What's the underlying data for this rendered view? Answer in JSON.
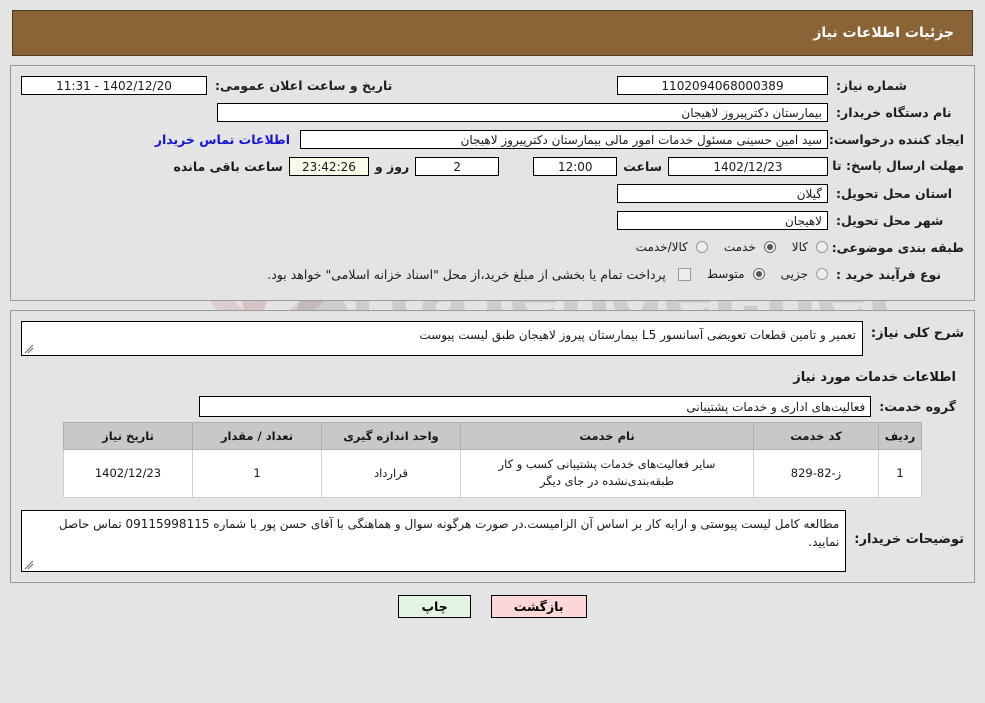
{
  "header": {
    "title": "جزئیات اطلاعات نیاز"
  },
  "watermark": {
    "text": "ArtaTender.net",
    "mark": "V"
  },
  "form": {
    "need_number_label": "شماره نیاز:",
    "need_number_value": "1102094068000389",
    "announce_label": "تاریخ و ساعت اعلان عمومی:",
    "announce_value": "11:31 - 1402/12/20",
    "buyer_org_label": "نام دستگاه خریدار:",
    "buyer_org_value": "بیمارستان دکترپیروز لاهیجان",
    "creator_label": "ایجاد کننده درخواست:",
    "creator_value": "سید امین حسینی مسئول خدمات امور مالی بیمارستان دکترپیروز لاهیجان",
    "contact_link": "اطلاعات تماس خریدار",
    "deadline_label": "مهلت ارسال پاسخ: تا تاریخ:",
    "deadline_date": "1402/12/23",
    "deadline_hour_label": "ساعت",
    "deadline_hour": "12:00",
    "remaining_days": "2",
    "remaining_days_label": "روز و",
    "remaining_time": "23:42:26",
    "remaining_suffix": "ساعت باقی مانده",
    "province_label": "استان محل تحویل:",
    "province_value": "گیلان",
    "city_label": "شهر محل تحویل:",
    "city_value": "لاهیجان",
    "category_label": "طبقه بندی موضوعی:",
    "category_options": [
      {
        "label": "کالا",
        "selected": false
      },
      {
        "label": "خدمت",
        "selected": true
      },
      {
        "label": "کالا/خدمت",
        "selected": false
      }
    ],
    "process_label": "نوع فرآیند خرید :",
    "process_options": [
      {
        "label": "جزیی",
        "selected": false
      },
      {
        "label": "متوسط",
        "selected": true
      }
    ],
    "treasury_checked": false,
    "treasury_note": "پرداخت تمام یا بخشی از مبلغ خرید،از محل \"اسناد خزانه اسلامی\" خواهد بود."
  },
  "description": {
    "label": "شرح کلی نیاز:",
    "value": "تعمیر و تامین قطعات تعویضی آسانسور L5  بیمارستان پیروز لاهیجان طبق لیست پیوست"
  },
  "services": {
    "heading": "اطلاعات خدمات مورد نیاز",
    "group_label": "گروه خدمت:",
    "group_value": "فعالیت‌های اداری و خدمات پشتیبانی",
    "columns": [
      "ردیف",
      "کد خدمت",
      "نام خدمت",
      "واحد اندازه گیری",
      "تعداد / مقدار",
      "تاریخ نیاز"
    ],
    "rows": [
      {
        "index": "1",
        "code": "ز-82-829",
        "name": "سایر فعالیت‌های خدمات پشتیبانی کسب و کار طبقه‌بندی‌نشده در جای دیگر",
        "unit": "قرارداد",
        "quantity": "1",
        "date": "1402/12/23"
      }
    ]
  },
  "buyer_notes": {
    "label": "توضیحات خریدار:",
    "value": "مطالعه کامل لیست پیوستی و ارایه کار بر اساس آن الزامیست.در صورت هرگونه سوال و هماهنگی با آقای حسن پور با شماره 09115998115 تماس حاصل نمایید."
  },
  "buttons": {
    "print": "چاپ",
    "back": "بازگشت"
  }
}
